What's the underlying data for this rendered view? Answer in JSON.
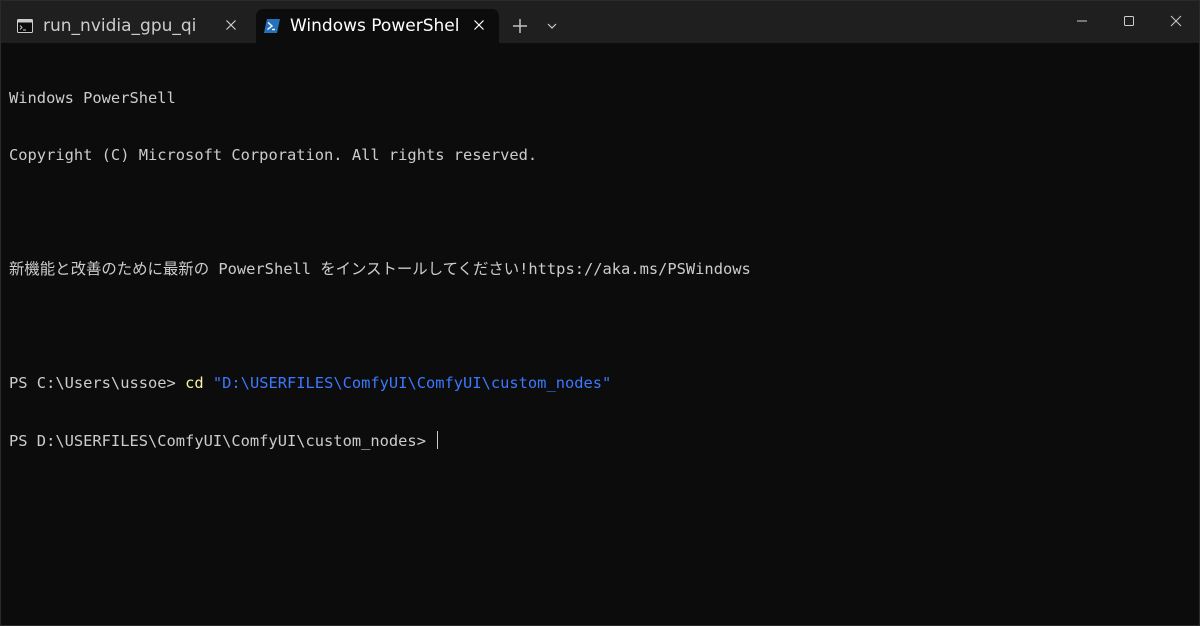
{
  "tabs": [
    {
      "title": "run_nvidia_gpu_qi",
      "icon": "terminal-icon",
      "active": false
    },
    {
      "title": "Windows PowerShell",
      "icon": "powershell-icon",
      "active": true
    }
  ],
  "toolbar": {
    "new_tab_icon": "plus-icon",
    "dropdown_icon": "chevron-down-icon"
  },
  "window_controls": {
    "minimize": "minimize-icon",
    "maximize": "maximize-icon",
    "close": "close-icon"
  },
  "terminal": {
    "banner_title": "Windows PowerShell",
    "copyright": "Copyright (C) Microsoft Corporation. All rights reserved.",
    "install_notice": "新機能と改善のために最新の PowerShell をインストールしてください!https://aka.ms/PSWindows",
    "prompt1": "PS C:\\Users\\ussoe> ",
    "command": "cd",
    "argument": " \"D:\\USERFILES\\ComfyUI\\ComfyUI\\custom_nodes\"",
    "prompt2": "PS D:\\USERFILES\\ComfyUI\\ComfyUI\\custom_nodes> "
  },
  "colors": {
    "background": "#0c0c0c",
    "titlebar": "#1f1f1f",
    "text": "#cccccc",
    "command": "#f9f1a5",
    "argument": "#3b78ff",
    "powershell_accent": "#2671be"
  }
}
